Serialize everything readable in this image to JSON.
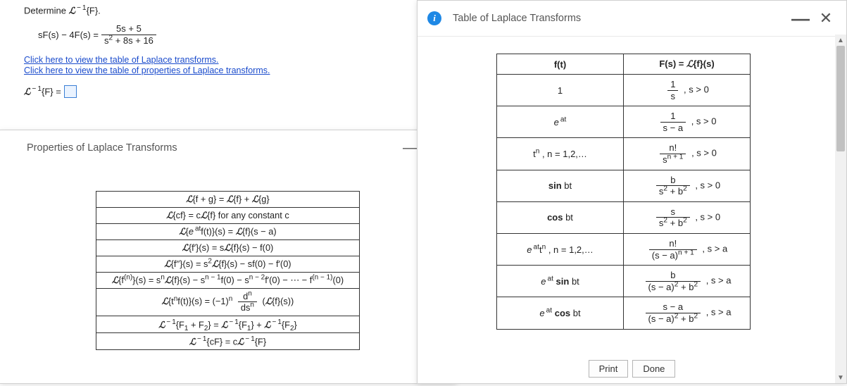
{
  "question": {
    "title_html": "Determine <span class='scriptL'>ℒ</span><span class='sup-neg1'> − 1</span>{F}.",
    "equation": {
      "lhs": "sF(s) − 4F(s) =",
      "frac_num": "5s + 5",
      "frac_den": "s<sup>2</sup> + 8s + 16"
    },
    "links": {
      "laplace_table": "Click here to view the table of Laplace transforms.",
      "properties_table": "Click here to view the table of properties of Laplace transforms."
    },
    "answer_prefix_html": "<span class='scriptL'>ℒ</span><span class='sup-neg1'> − 1</span>{F} ="
  },
  "properties_dialog": {
    "title": "Properties of Laplace Transforms",
    "rows": [
      "<span class='scriptL'>ℒ</span>{f + g} = <span class='scriptL'>ℒ</span>{f} + <span class='scriptL'>ℒ</span>{g}",
      "<span class='scriptL'>ℒ</span>{cf} = c<span class='scriptL'>ℒ</span>{f} for any constant c",
      "<span class='scriptL'>ℒ</span>{<span class='ital'>e</span><sup> at</sup>f(t)}(s) = <span class='scriptL'>ℒ</span>{f}(s − a)",
      "<span class='scriptL'>ℒ</span>{f′}(s) = s<span class='scriptL'>ℒ</span>{f}(s) − f(0)",
      "<span class='scriptL'>ℒ</span>{f′′}(s) = s<sup>2</sup><span class='scriptL'>ℒ</span>{f}(s) − sf(0) − f′(0)",
      "<span class='scriptL'>ℒ</span>{f<sup>(n)</sup>}(s) = s<sup>n</sup><span class='scriptL'>ℒ</span>{f}(s) − s<sup>n − 1</sup>f(0) − s<sup>n − 2</sup>f′(0) − ⋯ − f<sup>(n − 1)</sup>(0)",
      "<span class='scriptL'>ℒ</span>{t<sup>n</sup>f(t)}(s) = (−1)<sup>n</sup> <span class='frac'><span class='num'>d<sup>n</sup></span><span class='den'>ds<sup>n</sup></span></span> (<span class='scriptL'>ℒ</span>{f}(s))",
      "<span class='scriptL'>ℒ</span><span class='sup-neg1'> − 1</span>{F<sub>1</sub> + F<sub>2</sub>} = <span class='scriptL'>ℒ</span><span class='sup-neg1'> − 1</span>{F<sub>1</sub>} + <span class='scriptL'>ℒ</span><span class='sup-neg1'> − 1</span>{F<sub>2</sub>}",
      "<span class='scriptL'>ℒ</span><span class='sup-neg1'> − 1</span>{cF} = c<span class='scriptL'>ℒ</span><span class='sup-neg1'> − 1</span>{F}"
    ]
  },
  "laplace_dialog": {
    "title": "Table of Laplace Transforms",
    "header": {
      "left": "f(t)",
      "right_html": "F(s) = <span class='scriptL'>ℒ</span>{f}(s)"
    },
    "rows": [
      {
        "ft": "1",
        "Fs": "<span class='frac'><span class='num'>1</span><span class='den'>s</span></span> , s > 0"
      },
      {
        "ft": "<span class='ital'>e</span><sup> at</sup>",
        "Fs": "<span class='frac'><span class='num'>1</span><span class='den'>s − a</span></span> , s > 0"
      },
      {
        "ft": "t<sup>n</sup> , n = 1,2,…",
        "Fs": "<span class='frac'><span class='num'>n!</span><span class='den'>s<sup>n + 1</sup></span></span> , s > 0"
      },
      {
        "ft": "<b>sin</b> bt",
        "Fs": "<span class='frac'><span class='num'>b</span><span class='den'>s<sup>2</sup> + b<sup>2</sup></span></span> , s > 0"
      },
      {
        "ft": "<b>cos</b> bt",
        "Fs": "<span class='frac'><span class='num'>s</span><span class='den'>s<sup>2</sup> + b<sup>2</sup></span></span> , s > 0"
      },
      {
        "ft": "<span class='ital'>e</span><sup> at</sup>t<sup>n</sup> , n = 1,2,…",
        "Fs": "<span class='frac'><span class='num'>n!</span><span class='den'>(s − a)<sup>n + 1</sup></span></span> , s > a"
      },
      {
        "ft": "<span class='ital'>e</span><sup> at</sup> <b>sin</b> bt",
        "Fs": "<span class='frac'><span class='num'>b</span><span class='den'>(s − a)<sup>2</sup> + b<sup>2</sup></span></span> , s > a"
      },
      {
        "ft": "<span class='ital'>e</span><sup> at</sup> <b>cos</b> bt",
        "Fs": "<span class='frac'><span class='num'>s − a</span><span class='den'>(s − a)<sup>2</sup> + b<sup>2</sup></span></span> , s > a"
      }
    ],
    "buttons": {
      "print": "Print",
      "done": "Done"
    }
  },
  "icons": {
    "info": "i",
    "minimize": "—",
    "close": "✕"
  }
}
